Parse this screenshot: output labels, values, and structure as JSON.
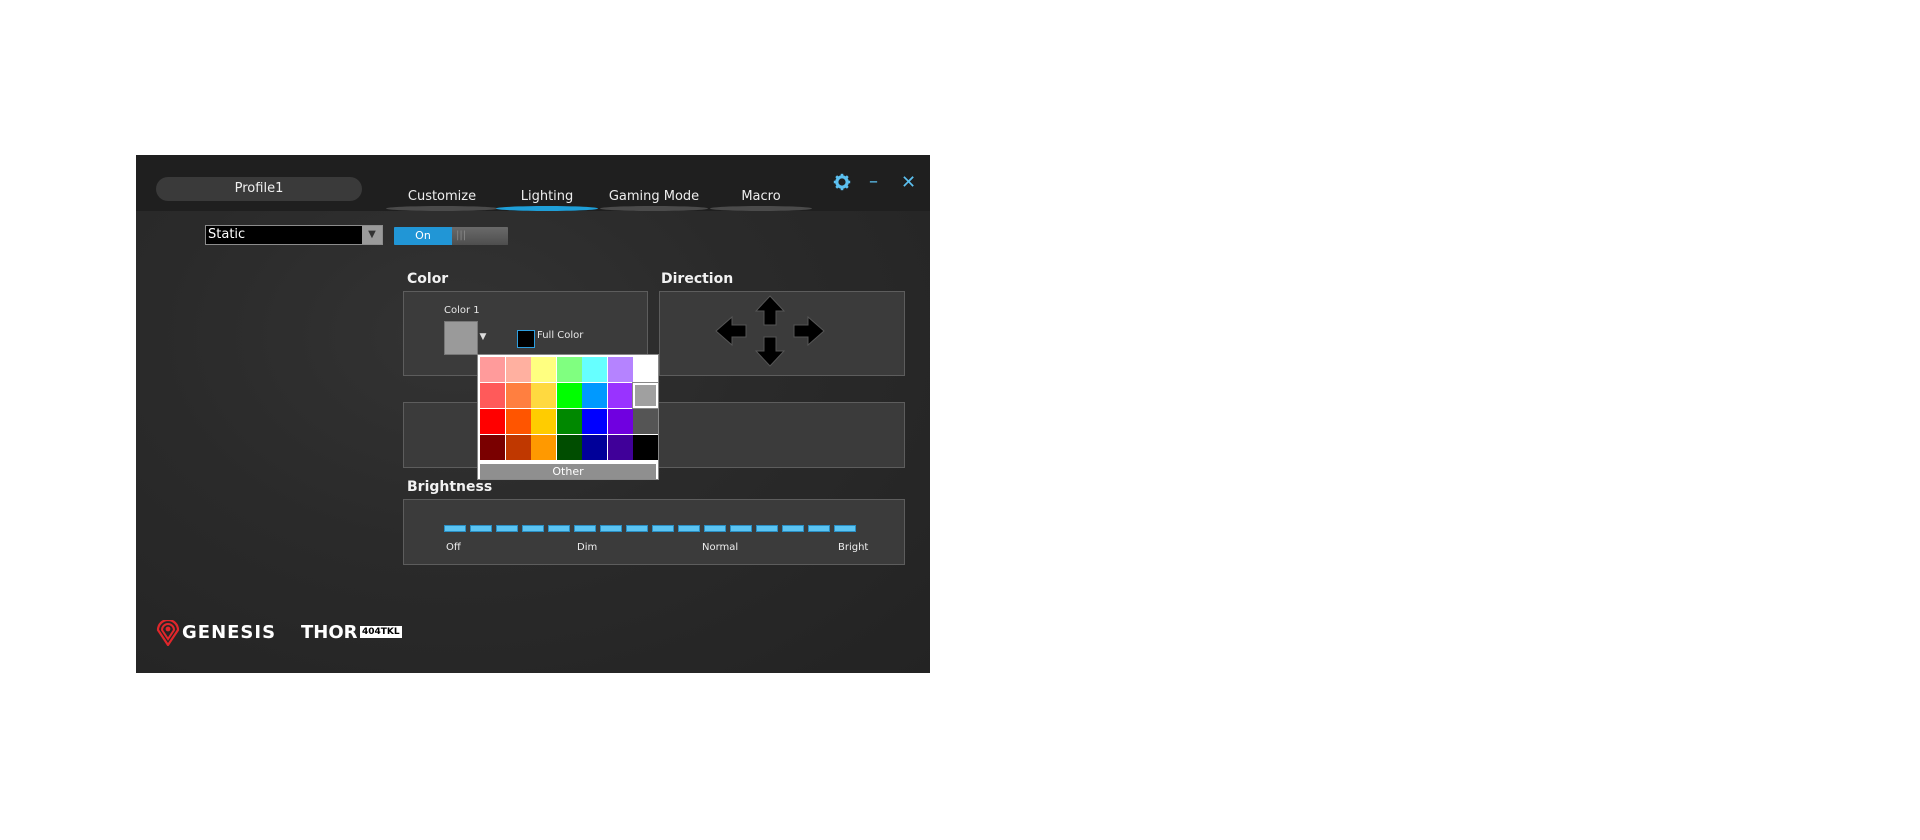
{
  "header": {
    "profile_name": "Profile1",
    "tabs": [
      {
        "label": "Customize",
        "active": false
      },
      {
        "label": "Lighting",
        "active": true
      },
      {
        "label": "Gaming Mode",
        "active": false
      },
      {
        "label": "Macro",
        "active": false
      }
    ],
    "controls": {
      "settings_icon": "gear-icon",
      "minimize_icon": "minimize-icon",
      "close_icon": "close-icon"
    }
  },
  "lighting": {
    "mode_value": "Static",
    "toggle_label": "On",
    "toggle_state": "on"
  },
  "color_section": {
    "title": "Color",
    "color1_label": "Color 1",
    "color1_value": "#9a9a9a",
    "full_color_label": "Full Color"
  },
  "direction_section": {
    "title": "Direction",
    "icons": [
      "arrow-up-icon",
      "arrow-left-icon",
      "arrow-right-icon",
      "arrow-down-icon"
    ]
  },
  "color_picker": {
    "rows": [
      [
        "#ff9b9b",
        "#ffb0a0",
        "#ffff80",
        "#80ff80",
        "#66ffff",
        "#b583ff",
        "#ffffff"
      ],
      [
        "#ff5a5a",
        "#ff7f40",
        "#ffd940",
        "#00ff00",
        "#0099ff",
        "#9933ff",
        "#a0a0a0"
      ],
      [
        "#ff0000",
        "#ff5500",
        "#ffcc00",
        "#008800",
        "#0000ff",
        "#7000e0",
        "#555555"
      ],
      [
        "#7a0000",
        "#c03800",
        "#ff9900",
        "#004d00",
        "#000099",
        "#400099",
        "#000000"
      ]
    ],
    "selected": "#a0a0a0",
    "other_label": "Other"
  },
  "brightness": {
    "title": "Brightness",
    "labels": [
      "Off",
      "Dim",
      "Normal",
      "Bright"
    ],
    "segments": 16,
    "level": 16
  },
  "branding": {
    "brand": "GENESIS",
    "model": "THOR",
    "model_badge": "404TKL"
  }
}
